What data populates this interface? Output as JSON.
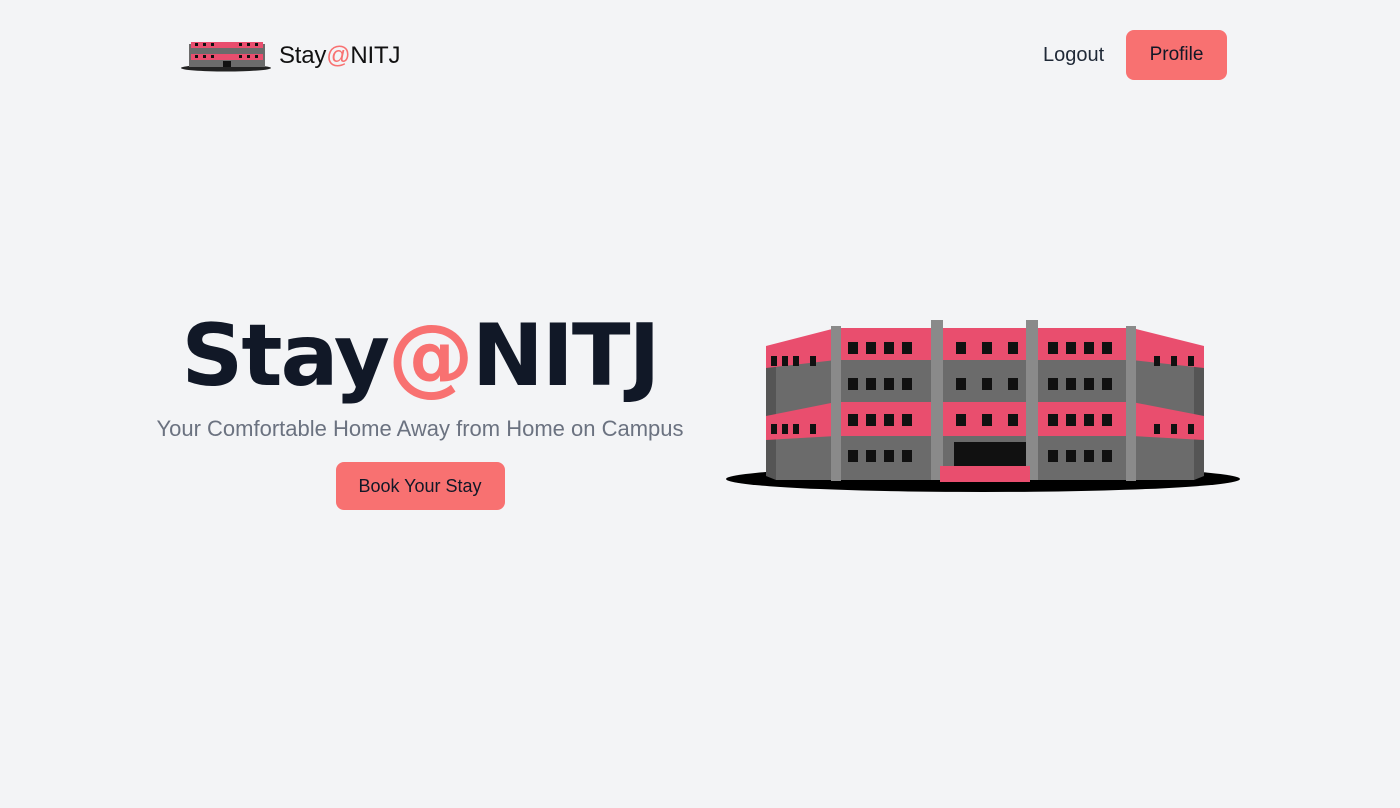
{
  "header": {
    "brand": {
      "prefix": "Stay",
      "at": "@",
      "suffix": "NITJ",
      "logo_icon": "hostel-building-icon"
    },
    "nav": {
      "logout_label": "Logout",
      "profile_label": "Profile"
    }
  },
  "hero": {
    "title": {
      "prefix": "Stay",
      "at": "@",
      "suffix": "NITJ"
    },
    "subtitle": "Your Comfortable Home Away from Home on Campus",
    "cta_label": "Book Your Stay",
    "illustration_icon": "hostel-building-icon"
  },
  "colors": {
    "accent": "#f87171",
    "background": "#f3f4f6",
    "title_text": "#111827",
    "subtitle_text": "#6b7280",
    "building_pink": "#e94e6e",
    "building_gray": "#6b6b6b"
  }
}
